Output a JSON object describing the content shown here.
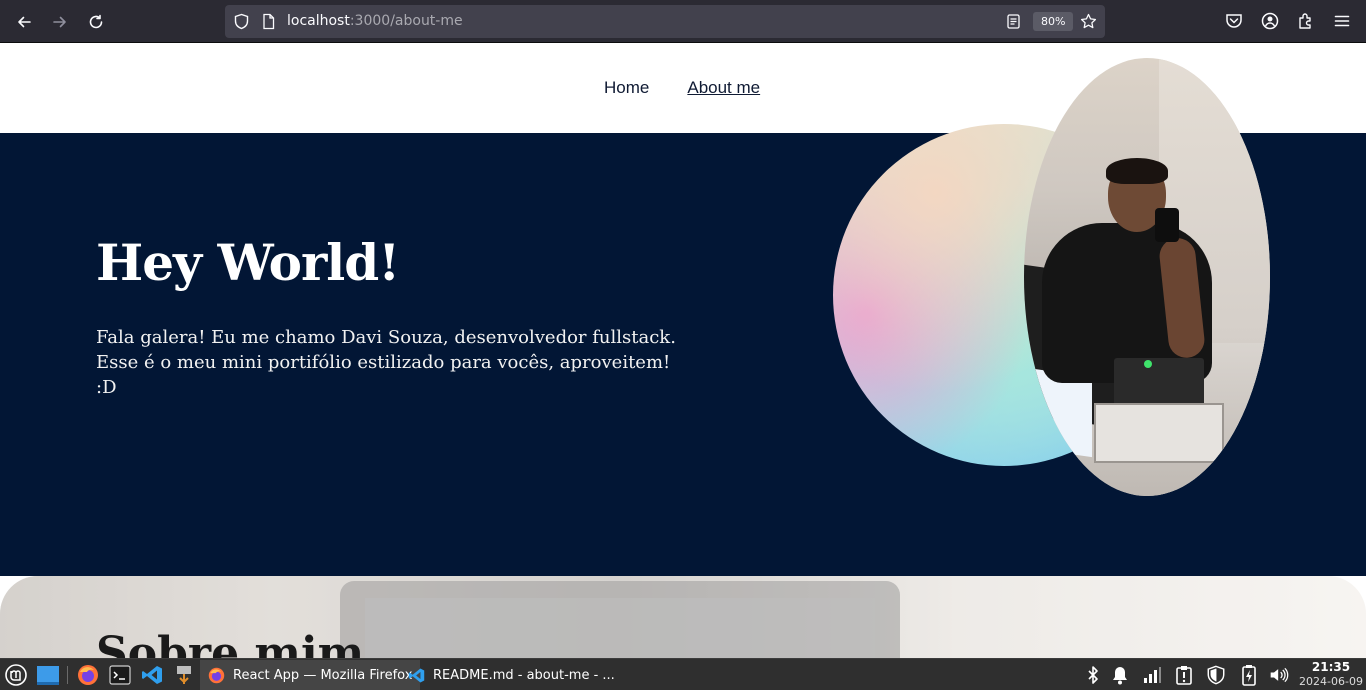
{
  "browser": {
    "url_host": "localhost",
    "url_path": ":3000/about-me",
    "zoom": "80%"
  },
  "site": {
    "nav": [
      {
        "label": "Home",
        "active": false
      },
      {
        "label": "About me",
        "active": true
      }
    ]
  },
  "hero": {
    "title": "Hey World!",
    "text": "Fala galera! Eu me chamo Davi Souza, desenvolvedor fullstack. Esse é o meu mini portifólio estilizado para vocês, aproveitem! :D"
  },
  "about": {
    "title": "Sobre mim"
  },
  "taskbar": {
    "tasks": [
      {
        "label": "React App — Mozilla Firefox",
        "icon": "firefox-icon",
        "active": true
      },
      {
        "label": "README.md - about-me - ...",
        "icon": "vscode-icon",
        "active": false
      }
    ],
    "clock_time": "21:35",
    "clock_date": "2024-06-09"
  },
  "colors": {
    "hero_bg": "#021635",
    "browser_bg": "#2b2a33",
    "taskbar_bg": "#2f2f2f"
  }
}
